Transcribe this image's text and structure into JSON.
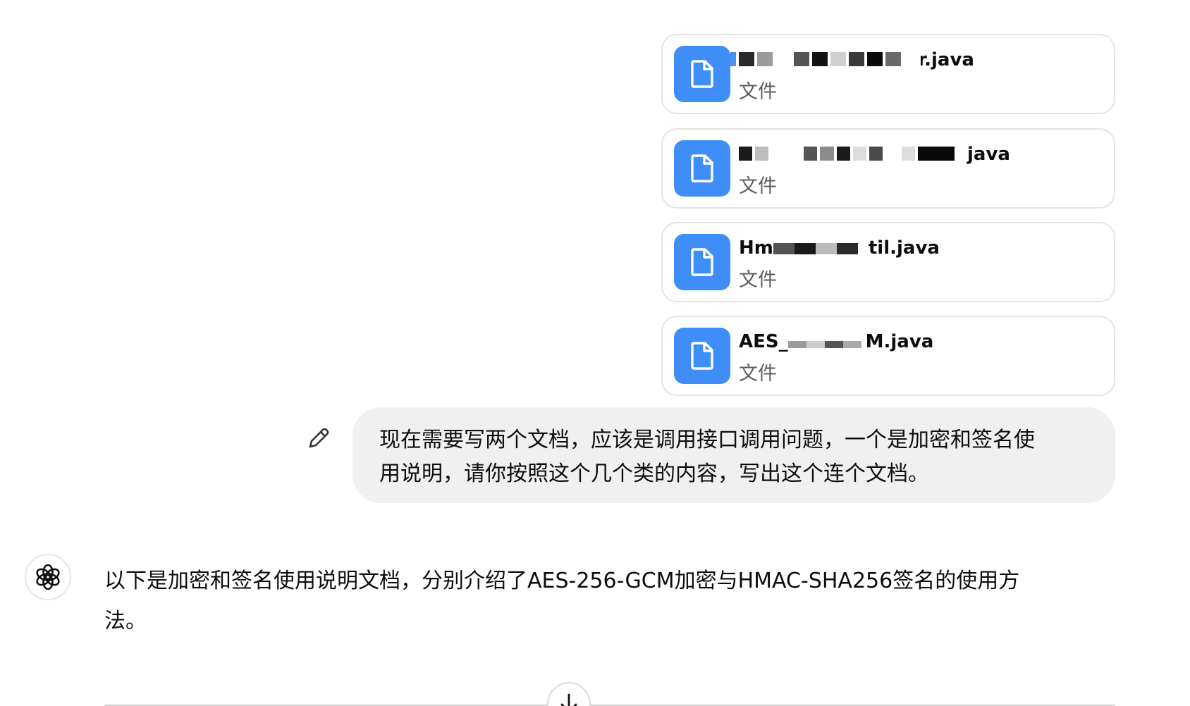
{
  "attachments": [
    {
      "name": "r.java",
      "type": "文件",
      "icon": "file-icon",
      "redacted": true
    },
    {
      "name": "java",
      "type": "文件",
      "icon": "file-icon",
      "redacted": true
    },
    {
      "name": "Hm til.java",
      "type": "文件",
      "icon": "file-icon",
      "redacted": true
    },
    {
      "name": "AES_ M.java",
      "type": "文件",
      "icon": "file-icon",
      "redacted": true
    }
  ],
  "user_message": {
    "line1": "现在需要写两个文档，应该是调用接口调用问题，一个是加密和签名使",
    "line2": "用说明，请你按照这个几个类的内容，写出这个连个文档。",
    "edit_icon": "pencil-icon"
  },
  "assistant_message": {
    "line1": "以下是加密和签名使用说明文档，分别介绍了AES-256-GCM加密与HMAC-SHA256签名的使用方",
    "line2": "法。",
    "avatar_icon": "openai-logo-icon"
  },
  "scroll_button": {
    "icon": "arrow-down-icon"
  },
  "colors": {
    "file_icon_bg": "#3f8ef7",
    "bubble_bg": "#f0f0f0",
    "card_border": "#e3e3e3",
    "secondary_text": "#5d5d5d"
  }
}
